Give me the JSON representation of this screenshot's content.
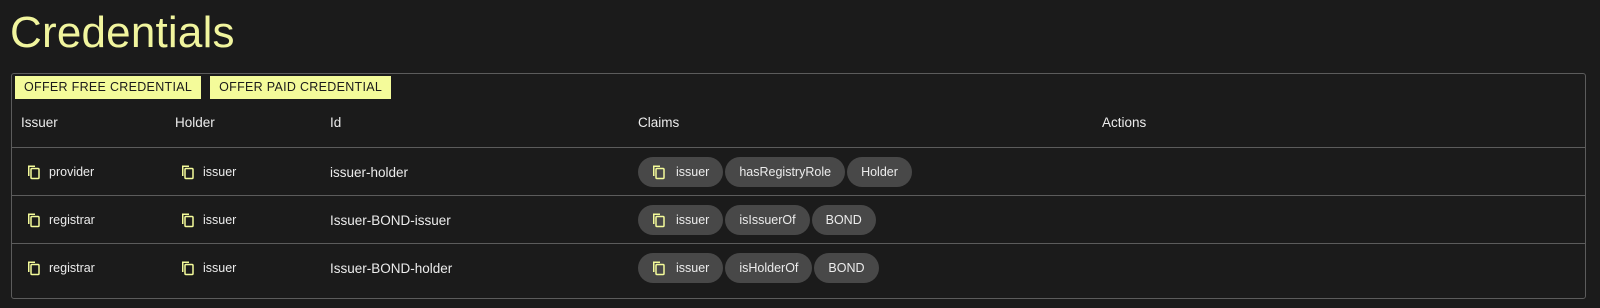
{
  "page": {
    "title": "Credentials"
  },
  "toolbar": {
    "offer_free_label": "OFFER FREE CREDENTIAL",
    "offer_paid_label": "OFFER PAID CREDENTIAL"
  },
  "table": {
    "headers": {
      "issuer": "Issuer",
      "holder": "Holder",
      "id": "Id",
      "claims": "Claims",
      "actions": "Actions"
    },
    "rows": [
      {
        "issuer": "provider",
        "holder": "issuer",
        "id": "issuer-holder",
        "claims": [
          "issuer",
          "hasRegistryRole",
          "Holder"
        ]
      },
      {
        "issuer": "registrar",
        "holder": "issuer",
        "id": "Issuer-BOND-issuer",
        "claims": [
          "issuer",
          "isIssuerOf",
          "BOND"
        ]
      },
      {
        "issuer": "registrar",
        "holder": "issuer",
        "id": "Issuer-BOND-holder",
        "claims": [
          "issuer",
          "isHolderOf",
          "BOND"
        ]
      }
    ]
  },
  "icons": {
    "copy": "copy-icon"
  },
  "colors": {
    "background": "#1b1b1b",
    "accent": "#f4fb9a",
    "title": "#f1f59e",
    "chip": "#484848",
    "border": "#5c5c5c"
  }
}
